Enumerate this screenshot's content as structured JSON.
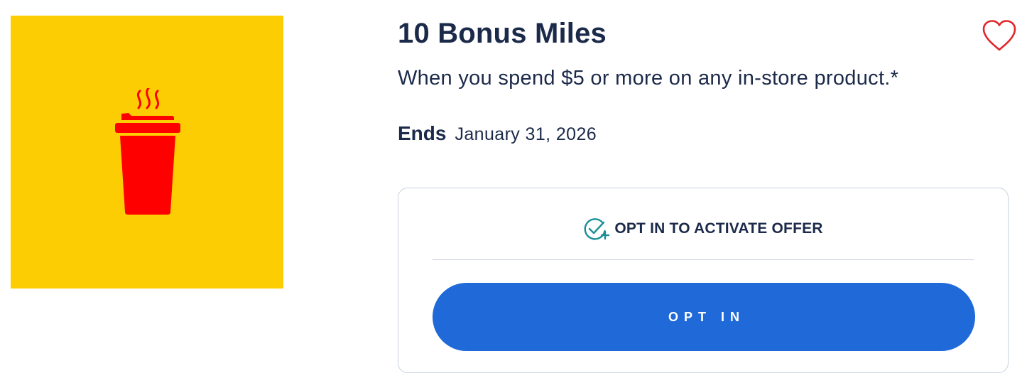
{
  "offer": {
    "image": {
      "icon": "coffee-cup-icon",
      "background_color": "#fccd03",
      "icon_color": "#ff0000"
    },
    "title": "10 Bonus Miles",
    "favorite_icon": "heart-outline-icon",
    "favorite_color": "#e0262b",
    "description": "When you spend $5 or more on any in-store product.*",
    "ends_label": "Ends",
    "ends_date": "January 31, 2026"
  },
  "optin": {
    "heading_icon": "check-circle-plus-icon",
    "heading_icon_color": "#1a8f97",
    "heading": "OPT IN TO ACTIVATE OFFER",
    "button_label": "OPT IN",
    "button_color": "#1f69d8"
  }
}
